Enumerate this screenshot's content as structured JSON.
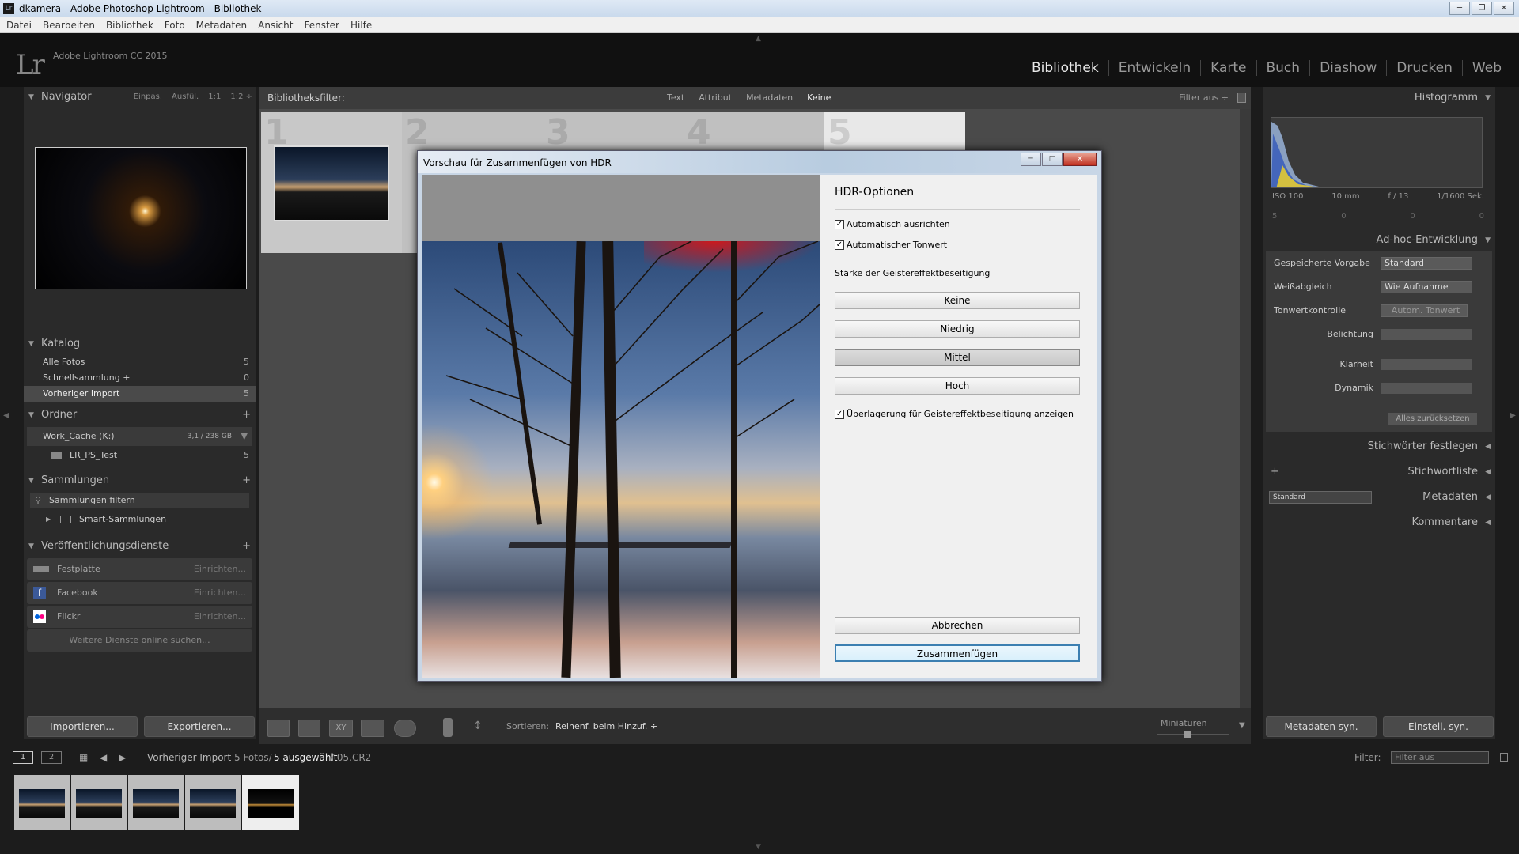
{
  "window": {
    "title": "dkamera - Adobe Photoshop Lightroom - Bibliothek",
    "icon": "Lr"
  },
  "menu": [
    "Datei",
    "Bearbeiten",
    "Bibliothek",
    "Foto",
    "Metadaten",
    "Ansicht",
    "Fenster",
    "Hilfe"
  ],
  "app": {
    "logo": "Lr",
    "version": "Adobe Lightroom CC 2015"
  },
  "modules": [
    "Bibliothek",
    "Entwickeln",
    "Karte",
    "Buch",
    "Diashow",
    "Drucken",
    "Web"
  ],
  "navigator": {
    "title": "Navigator",
    "zoom": [
      "Einpas.",
      "Ausfül.",
      "1:1",
      "1:2 ÷"
    ]
  },
  "catalog": {
    "title": "Katalog",
    "items": [
      {
        "label": "Alle Fotos",
        "count": "5"
      },
      {
        "label": "Schnellsammlung +",
        "count": "0"
      },
      {
        "label": "Vorheriger Import",
        "count": "5"
      }
    ]
  },
  "folders": {
    "title": "Ordner",
    "plus": "+",
    "volume": "Work_Cache (K:)",
    "volume_size": "3,1 / 238 GB",
    "folder": "LR_PS_Test",
    "folder_count": "5"
  },
  "collections": {
    "title": "Sammlungen",
    "plus": "+",
    "filter": "Sammlungen filtern",
    "smart": "Smart-Sammlungen"
  },
  "publish": {
    "title": "Veröffentlichungsdienste",
    "plus": "+",
    "services": [
      {
        "label": "Festplatte",
        "setup": "Einrichten..."
      },
      {
        "label": "Facebook",
        "setup": "Einrichten..."
      },
      {
        "label": "Flickr",
        "setup": "Einrichten..."
      }
    ],
    "more": "Weitere Dienste online suchen..."
  },
  "left_buttons": {
    "import": "Importieren...",
    "export": "Exportieren..."
  },
  "filterbar": {
    "label": "Bibliotheksfilter:",
    "options": [
      "Text",
      "Attribut",
      "Metadaten",
      "Keine"
    ],
    "filter_off": "Filter aus ÷"
  },
  "grid_numbers": [
    "1",
    "2",
    "3",
    "4",
    "5"
  ],
  "toolbar": {
    "sort_label": "Sortieren:",
    "sort_value": "Reihenf. beim Hinzuf. ÷",
    "thumbs": "Miniaturen"
  },
  "dialog": {
    "title": "Vorschau für Zusammenfügen von HDR",
    "options_title": "HDR-Optionen",
    "auto_align": "Automatisch ausrichten",
    "auto_tone": "Automatischer Tonwert",
    "deghost_label": "Stärke der Geistereffektbeseitigung",
    "deghost_options": [
      "Keine",
      "Niedrig",
      "Mittel",
      "Hoch"
    ],
    "overlay": "Überlagerung für Geistereffektbeseitigung anzeigen",
    "cancel": "Abbrechen",
    "merge": "Zusammenfügen",
    "check": "✓",
    "winbtns": [
      "─",
      "□",
      "✕"
    ]
  },
  "histogram": {
    "title": "Histogramm",
    "iso": "ISO 100",
    "focal": "10 mm",
    "aperture": "f / 13",
    "shutter": "1/1600 Sek.",
    "count": "5",
    "zeros": [
      "0",
      "0",
      "0"
    ]
  },
  "quickdev": {
    "title": "Ad-hoc-Entwicklung",
    "preset_label": "Gespeicherte Vorgabe",
    "preset_value": "Standard",
    "wb_label": "Weißabgleich",
    "wb_value": "Wie Aufnahme",
    "tone_label": "Tonwertkontrolle",
    "tone_value": "Autom. Tonwert",
    "exposure": "Belichtung",
    "clarity": "Klarheit",
    "vibrance": "Dynamik",
    "reset": "Alles zurücksetzen"
  },
  "right_panels": {
    "keywording": "Stichwörter festlegen",
    "keywordlist": "Stichwortliste",
    "metadata": "Metadaten",
    "metadata_preset": "Standard",
    "comments": "Kommentare"
  },
  "right_buttons": {
    "sync_meta": "Metadaten syn.",
    "sync_settings": "Einstell. syn."
  },
  "filmstrip": {
    "screen1": "1",
    "screen2": "2",
    "source": "Vorheriger Import",
    "count": "5 Fotos/",
    "selected": "5 ausgewählt",
    "file": "/ 05.CR2",
    "filter_label": "Filter:",
    "filter_value": "Filter aus"
  },
  "colors": {
    "panel": "#2a2a2a",
    "accent": "#e8e8e8",
    "dialog": "#f0f0f0"
  }
}
